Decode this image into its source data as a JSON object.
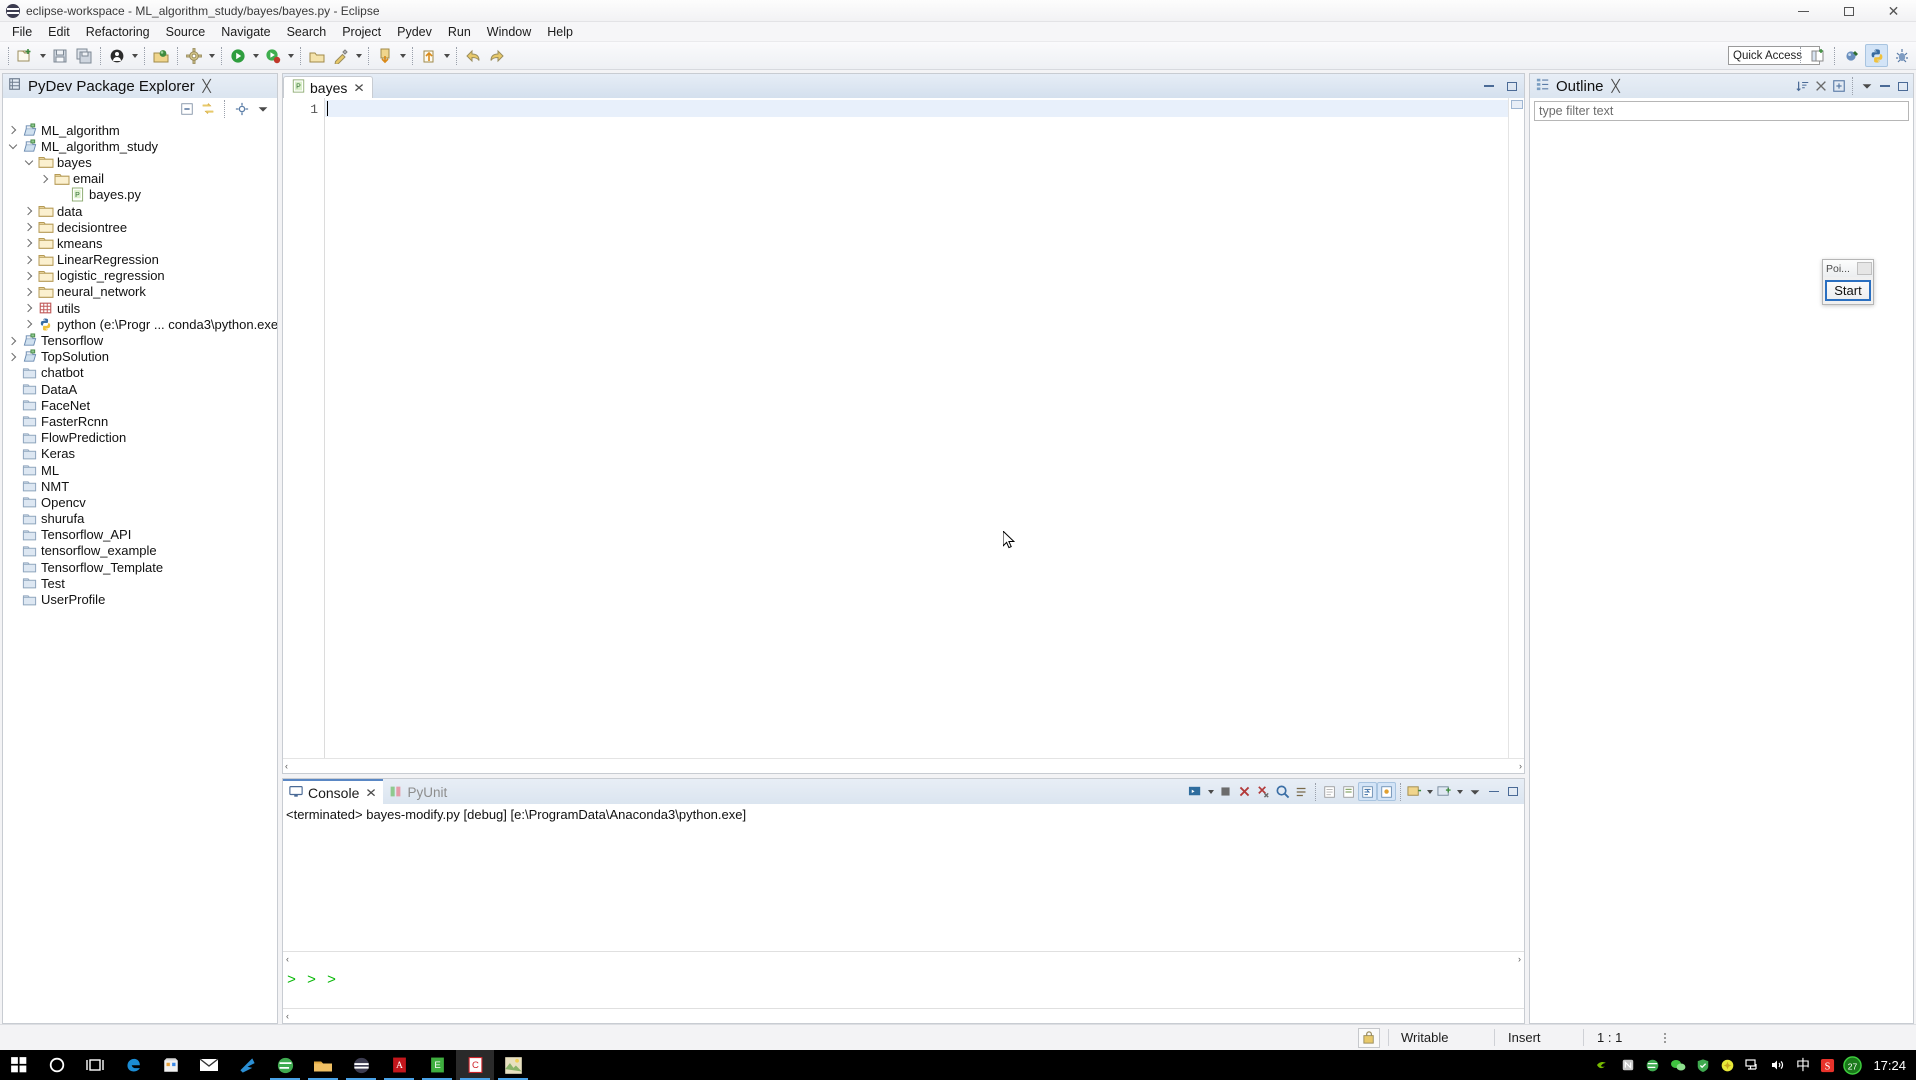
{
  "window": {
    "title": "eclipse-workspace - ML_algorithm_study/bayes/bayes.py - Eclipse",
    "app_icon": "eclipse-icon",
    "minimize": "–",
    "maximize": "❑",
    "close": "✕"
  },
  "menubar": {
    "items": [
      {
        "label": "File"
      },
      {
        "label": "Edit"
      },
      {
        "label": "Refactoring"
      },
      {
        "label": "Source"
      },
      {
        "label": "Navigate"
      },
      {
        "label": "Search"
      },
      {
        "label": "Project"
      },
      {
        "label": "Pydev"
      },
      {
        "label": "Run"
      },
      {
        "label": "Window"
      },
      {
        "label": "Help"
      }
    ]
  },
  "toolbar": {
    "quick_access_placeholder": "Quick Access",
    "buttons": [
      "new-wizard-icon",
      "save-icon",
      "save-all-icon",
      "print-icon",
      "open-type-icon",
      "build-icon",
      "run-icon",
      "debug-icon",
      "coverage-icon",
      "external-tools-icon",
      "pin-icon",
      "next-annotation-icon",
      "previous-annotation-icon",
      "back-icon",
      "forward-icon"
    ],
    "perspective_buttons": [
      "open-perspective-icon",
      "debug-perspective-icon",
      "pydev-perspective-icon",
      "pydev-debug-perspective-icon"
    ]
  },
  "explorer": {
    "title": "PyDev Package Explorer",
    "title_icon": "package-explorer-icon",
    "close_icon": "close-icon",
    "tools": [
      "collapse-all-icon",
      "link-with-editor-icon",
      "focus-on-active-task-icon",
      "view-menu-icon"
    ],
    "tree": [
      {
        "label": "ML_algorithm",
        "indent": 0,
        "twisty": "collapsed",
        "icon": "pydev-project-icon"
      },
      {
        "label": "ML_algorithm_study",
        "indent": 0,
        "twisty": "expanded",
        "icon": "pydev-project-icon"
      },
      {
        "label": "bayes",
        "indent": 1,
        "twisty": "expanded",
        "icon": "folder-icon"
      },
      {
        "label": "email",
        "indent": 2,
        "twisty": "collapsed",
        "icon": "folder-icon"
      },
      {
        "label": "bayes.py",
        "indent": 3,
        "twisty": "none",
        "icon": "python-file-icon"
      },
      {
        "label": "data",
        "indent": 1,
        "twisty": "collapsed",
        "icon": "folder-icon"
      },
      {
        "label": "decisiontree",
        "indent": 1,
        "twisty": "collapsed",
        "icon": "folder-icon"
      },
      {
        "label": "kmeans",
        "indent": 1,
        "twisty": "collapsed",
        "icon": "folder-icon"
      },
      {
        "label": "LinearRegression",
        "indent": 1,
        "twisty": "collapsed",
        "icon": "folder-icon"
      },
      {
        "label": "logistic_regression",
        "indent": 1,
        "twisty": "collapsed",
        "icon": "folder-icon"
      },
      {
        "label": "neural_network",
        "indent": 1,
        "twisty": "collapsed",
        "icon": "folder-icon"
      },
      {
        "label": "utils",
        "indent": 1,
        "twisty": "collapsed",
        "icon": "source-folder-icon"
      },
      {
        "label": "python  (e:\\Progr ... conda3\\python.exe)",
        "indent": 1,
        "twisty": "collapsed",
        "icon": "python-interpreter-icon"
      },
      {
        "label": "Tensorflow",
        "indent": 0,
        "twisty": "collapsed",
        "icon": "pydev-project-icon"
      },
      {
        "label": "TopSolution",
        "indent": 0,
        "twisty": "collapsed",
        "icon": "pydev-project-icon"
      },
      {
        "label": "chatbot",
        "indent": 0,
        "twisty": "none",
        "icon": "closed-project-icon"
      },
      {
        "label": "DataA",
        "indent": 0,
        "twisty": "none",
        "icon": "closed-project-icon"
      },
      {
        "label": "FaceNet",
        "indent": 0,
        "twisty": "none",
        "icon": "closed-project-icon"
      },
      {
        "label": "FasterRcnn",
        "indent": 0,
        "twisty": "none",
        "icon": "closed-project-icon"
      },
      {
        "label": "FlowPrediction",
        "indent": 0,
        "twisty": "none",
        "icon": "closed-project-icon"
      },
      {
        "label": "Keras",
        "indent": 0,
        "twisty": "none",
        "icon": "closed-project-icon"
      },
      {
        "label": "ML",
        "indent": 0,
        "twisty": "none",
        "icon": "closed-project-icon"
      },
      {
        "label": "NMT",
        "indent": 0,
        "twisty": "none",
        "icon": "closed-project-icon"
      },
      {
        "label": "Opencv",
        "indent": 0,
        "twisty": "none",
        "icon": "closed-project-icon"
      },
      {
        "label": "shurufa",
        "indent": 0,
        "twisty": "none",
        "icon": "closed-project-icon"
      },
      {
        "label": "Tensorflow_API",
        "indent": 0,
        "twisty": "none",
        "icon": "closed-project-icon"
      },
      {
        "label": "tensorflow_example",
        "indent": 0,
        "twisty": "none",
        "icon": "closed-project-icon"
      },
      {
        "label": "Tensorflow_Template",
        "indent": 0,
        "twisty": "none",
        "icon": "closed-project-icon"
      },
      {
        "label": "Test",
        "indent": 0,
        "twisty": "none",
        "icon": "closed-project-icon"
      },
      {
        "label": "UserProfile",
        "indent": 0,
        "twisty": "none",
        "icon": "closed-project-icon"
      }
    ]
  },
  "editor": {
    "tab_label": "bayes",
    "tab_icon": "python-file-icon",
    "tab_close": "✕",
    "minimize": "–",
    "maximize": "❑",
    "line_numbers": [
      "1"
    ],
    "content": "",
    "scroll_left": "‹",
    "scroll_right": "›"
  },
  "console": {
    "tabs": [
      {
        "label": "Console",
        "icon": "console-icon",
        "active": true,
        "close": "✕"
      },
      {
        "label": "PyUnit",
        "icon": "pyunit-icon",
        "active": false
      }
    ],
    "output_line": "<terminated> bayes-modify.py [debug] [e:\\ProgramData\\Anaconda3\\python.exe]",
    "prompt": "> > >",
    "tools": [
      "display-selected-console-icon",
      "terminate-icon",
      "remove-launch-icon",
      "remove-all-terminated-icon",
      "clear-console-icon",
      "find-icon",
      "open-console-icon",
      "scroll-lock-icon",
      "word-wrap-icon",
      "pin-console-icon",
      "show-console-on-output-icon",
      "new-console-view-icon",
      "view-menu-icon",
      "minimize-icon",
      "maximize-icon"
    ],
    "scroll_left": "‹",
    "scroll_right": "›"
  },
  "outline": {
    "title": "Outline",
    "title_icon": "outline-icon",
    "close_icon": "close-icon",
    "filter_placeholder": "type filter text",
    "tools": [
      "sort-icon",
      "hide-fields-icon",
      "expand-all-icon",
      "collapse-all-icon",
      "view-menu-icon",
      "minimize-icon",
      "maximize-icon"
    ]
  },
  "popup": {
    "title": "Poi...",
    "close_label": "",
    "button_label": "Start"
  },
  "statusbar": {
    "lock_icon": "writable-lock-icon",
    "writable": "Writable",
    "insert_mode": "Insert",
    "position": "1 : 1"
  },
  "taskbar": {
    "start_icon": "windows-start-icon",
    "items": [
      {
        "icon": "cortana-search-icon",
        "running": false
      },
      {
        "icon": "task-view-icon",
        "running": false
      },
      {
        "icon": "edge-icon",
        "running": false
      },
      {
        "icon": "store-icon",
        "running": false
      },
      {
        "icon": "mail-icon",
        "running": false
      },
      {
        "icon": "foxmail-icon",
        "running": false
      },
      {
        "icon": "browser-icon",
        "running": true
      },
      {
        "icon": "file-explorer-icon",
        "running": true
      },
      {
        "icon": "eclipse-icon",
        "running": true
      },
      {
        "icon": "pdf-reader-icon",
        "running": true
      },
      {
        "icon": "editplus-icon",
        "running": true
      },
      {
        "icon": "clion-icon",
        "running": true,
        "active": true
      },
      {
        "icon": "snipping-tool-icon",
        "running": true
      }
    ],
    "tray": [
      {
        "icon": "nvidia-icon"
      },
      {
        "icon": "nfc-icon"
      },
      {
        "icon": "browser-tray-icon"
      },
      {
        "icon": "wechat-icon"
      },
      {
        "icon": "security-shield-icon"
      },
      {
        "icon": "update-icon"
      },
      {
        "icon": "network-icon"
      },
      {
        "icon": "volume-icon"
      }
    ],
    "ime_label": "中",
    "sogou_icon": "sogou-icon",
    "weather_badge": "27",
    "clock": "17:24"
  },
  "colors": {
    "accent": "#5a87c4",
    "tab_active_bg": "#ffffff",
    "panel_header": "#dbe5f0",
    "prompt_green": "#0ab80a",
    "focus_blue": "#2a6fc0"
  }
}
